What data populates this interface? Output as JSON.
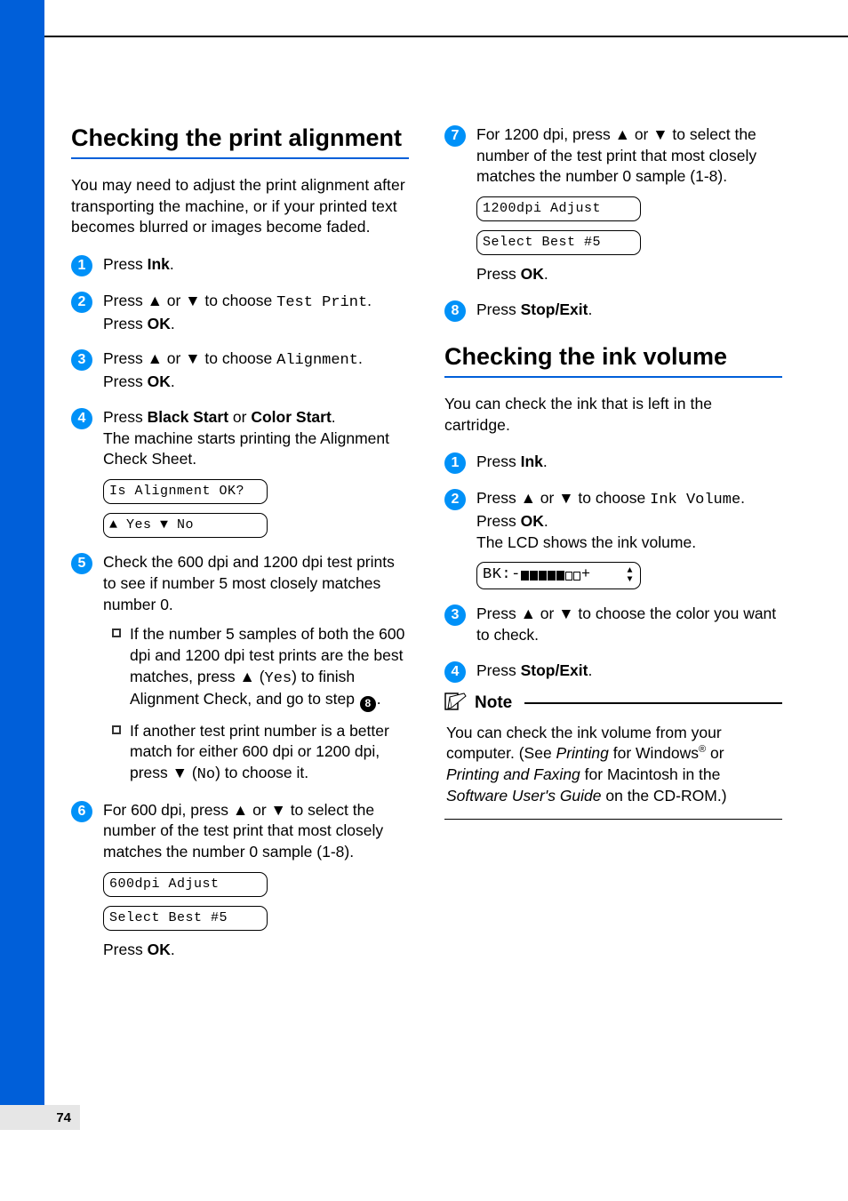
{
  "page_number": "74",
  "left": {
    "heading": "Checking the print alignment",
    "intro": "You may need to adjust the print alignment after transporting the machine, or if your printed text becomes blurred or images become faded.",
    "steps": {
      "s1_pre": "Press ",
      "s1_b": "Ink",
      "s1_post": ".",
      "s2_pre": "Press ▲ or ▼ to choose ",
      "s2_mono": "Test Print",
      "s2_post": ".",
      "s2_l2_pre": "Press ",
      "s2_l2_b": "OK",
      "s2_l2_post": ".",
      "s3_pre": "Press ▲ or ▼ to choose ",
      "s3_mono": "Alignment",
      "s3_post": ".",
      "s3_l2_pre": "Press ",
      "s3_l2_b": "OK",
      "s3_l2_post": ".",
      "s4_pre": "Press ",
      "s4_b1": "Black Start",
      "s4_mid": " or ",
      "s4_b2": "Color Start",
      "s4_post": ".",
      "s4_l2": "The machine starts printing the Alignment Check Sheet.",
      "lcd1": "Is Alignment OK?",
      "lcd2": "▲ Yes ▼ No",
      "s5_l1": "Check the 600 dpi and 1200 dpi test prints to see if number 5 most closely matches number 0.",
      "s5_b1_pre": "If the number 5 samples of both the 600 dpi and 1200 dpi test prints are the best matches, press ▲ (",
      "s5_b1_mono": "Yes",
      "s5_b1_mid": ") to finish Alignment Check, and go to step ",
      "s5_b1_badge": "8",
      "s5_b1_post": ".",
      "s5_b2_pre": "If another test print number is a better match for either 600 dpi or 1200 dpi, press ▼ (",
      "s5_b2_mono": "No",
      "s5_b2_post": ") to choose it.",
      "s6_l1": "For 600 dpi, press ▲ or ▼ to select the number of the test print that most closely matches the number 0 sample (1-8).",
      "lcd3": "600dpi Adjust",
      "lcd4": "Select Best #5",
      "s6_ok_pre": "Press ",
      "s6_ok_b": "OK",
      "s6_ok_post": "."
    }
  },
  "right": {
    "steps": {
      "s7_l1": "For 1200 dpi, press ▲ or ▼ to select the number of the test print that most closely matches the number 0 sample (1-8).",
      "lcd1": "1200dpi Adjust",
      "lcd2": "Select Best #5",
      "s7_ok_pre": "Press ",
      "s7_ok_b": "OK",
      "s7_ok_post": ".",
      "s8_pre": "Press ",
      "s8_b": "Stop/Exit",
      "s8_post": "."
    },
    "heading": "Checking the ink volume",
    "intro": "You can check the ink that is left in the cartridge.",
    "vsteps": {
      "s1_pre": "Press ",
      "s1_b": "Ink",
      "s1_post": ".",
      "s2_pre": "Press ▲ or ▼ to choose ",
      "s2_mono": "Ink Volume",
      "s2_post": ".",
      "s2_l2_pre": "Press ",
      "s2_l2_b": "OK",
      "s2_l2_post": ".",
      "s2_l3": "The LCD shows the ink volume.",
      "lcd_prefix": "BK:-",
      "lcd_suffix": "+",
      "s3": "Press ▲ or ▼ to choose the color you want to check.",
      "s4_pre": "Press ",
      "s4_b": "Stop/Exit",
      "s4_post": "."
    },
    "note_title": "Note",
    "note_l1": "You can check the ink volume from your computer. (See ",
    "note_i1": "Printing",
    "note_mid1": " for Windows",
    "note_sup": "®",
    "note_mid2": " or ",
    "note_i2": "Printing and Faxing",
    "note_mid3": " for Macintosh in the ",
    "note_i3": "Software User's Guide",
    "note_end": " on the CD-ROM.)"
  }
}
